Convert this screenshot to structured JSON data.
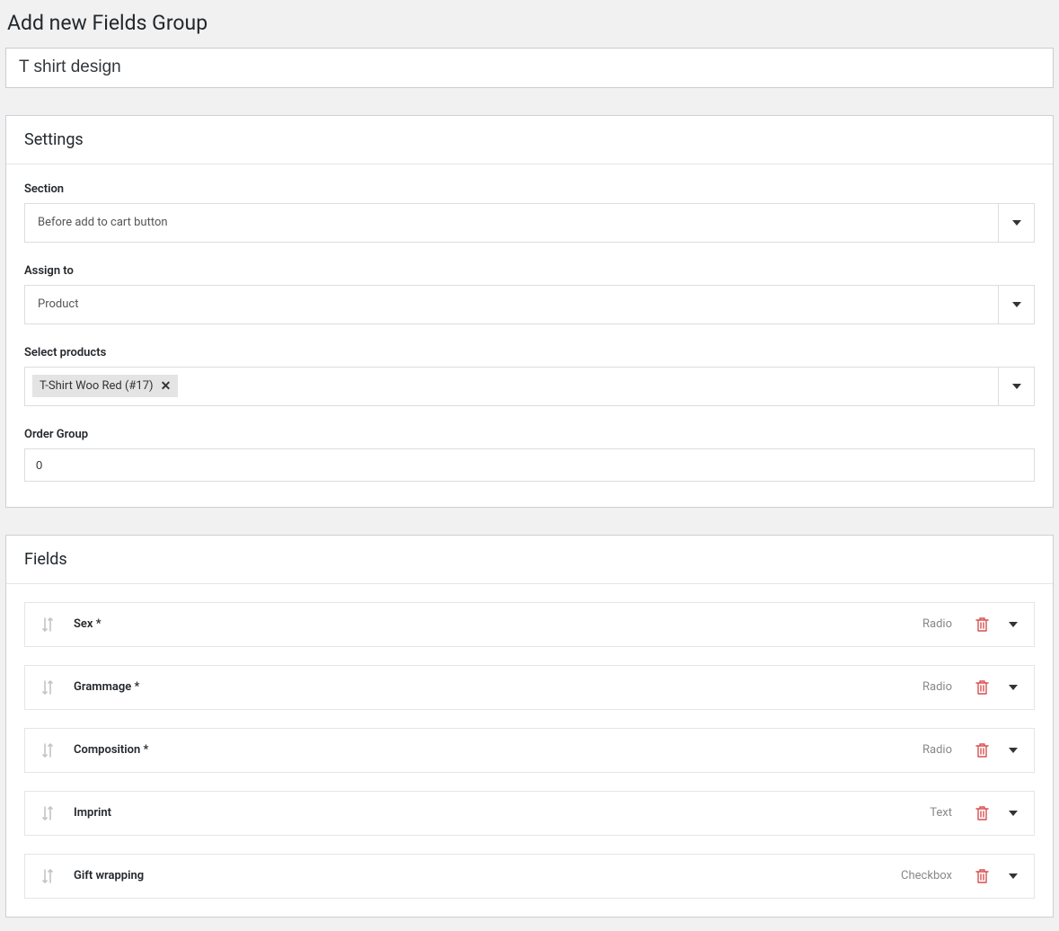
{
  "page_title": "Add new Fields Group",
  "title_value": "T shirt design",
  "settings": {
    "panel_title": "Settings",
    "section_label": "Section",
    "section_value": "Before add to cart button",
    "assign_label": "Assign to",
    "assign_value": "Product",
    "select_products_label": "Select products",
    "selected_product": "T-Shirt Woo Red (#17)",
    "order_label": "Order Group",
    "order_value": "0"
  },
  "fields": {
    "panel_title": "Fields",
    "rows": [
      {
        "name": "Sex *",
        "type": "Radio"
      },
      {
        "name": "Grammage *",
        "type": "Radio"
      },
      {
        "name": "Composition *",
        "type": "Radio"
      },
      {
        "name": "Imprint",
        "type": "Text"
      },
      {
        "name": "Gift wrapping",
        "type": "Checkbox"
      }
    ]
  }
}
